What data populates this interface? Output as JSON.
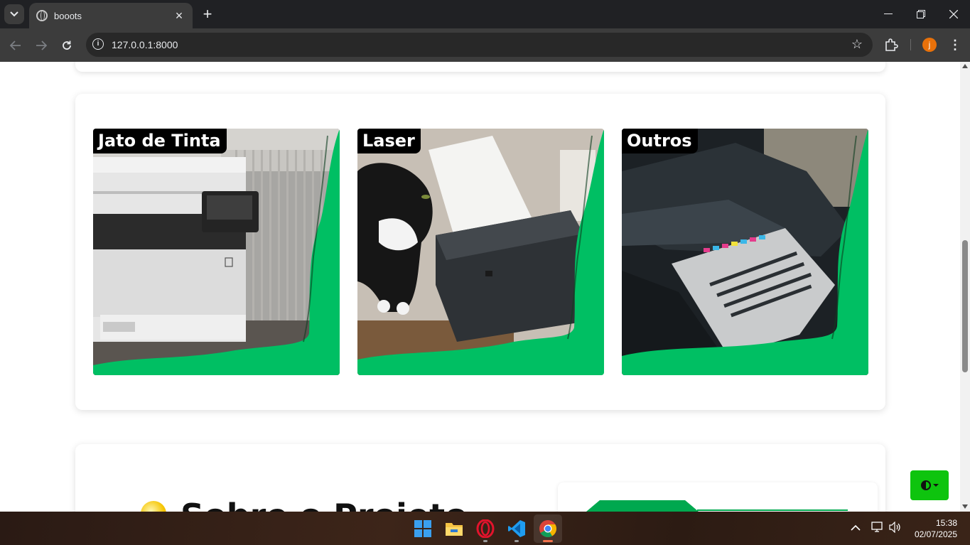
{
  "browser": {
    "tab_title": "booots",
    "url": "127.0.0.1:8000",
    "profile_initial": "j"
  },
  "categories": [
    {
      "label": "Jato de Tinta"
    },
    {
      "label": "Laser"
    },
    {
      "label": "Outros"
    }
  ],
  "bottom_section": {
    "heading": "Sobre o Projeto"
  },
  "colors": {
    "accent_green": "#00bf63",
    "theme_button": "#0ec40e"
  },
  "taskbar": {
    "apps": [
      "windows-start",
      "file-explorer",
      "opera",
      "vscode",
      "chrome"
    ],
    "time": "15:38",
    "date": "02/07/2025"
  }
}
